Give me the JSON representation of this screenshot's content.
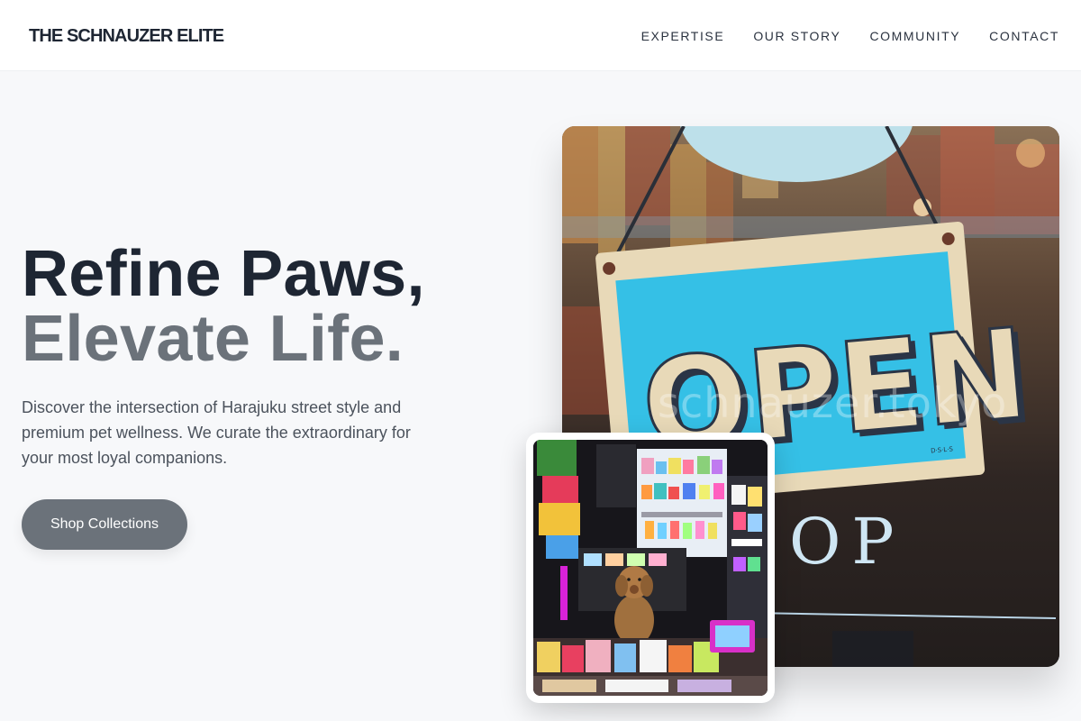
{
  "header": {
    "brand": "THE SCHNAUZER ELITE",
    "nav": [
      {
        "label": "EXPERTISE"
      },
      {
        "label": "OUR STORY"
      },
      {
        "label": "COMMUNITY"
      },
      {
        "label": "CONTACT"
      }
    ]
  },
  "hero": {
    "title_line1": "Refine Paws,",
    "title_line2": "Elevate Life.",
    "description": "Discover the intersection of Harajuku street style and premium pet wellness. We curate the extraordinary for your most loyal companions.",
    "cta_label": "Shop Collections"
  },
  "images": {
    "main": {
      "sign_text": "OPEN",
      "glass_text": "OP",
      "watermark": "schnauzer.tokyo",
      "small_print": "D·S·L·S"
    },
    "card": {
      "subject": "poodle-in-shop"
    }
  },
  "colors": {
    "primary_text": "#1e2633",
    "muted_text": "#6b727a",
    "accent_button": "#6b727a",
    "background": "#f7f8fa",
    "sign_blue": "#35c0e6",
    "sign_cream": "#e8d9b8"
  }
}
